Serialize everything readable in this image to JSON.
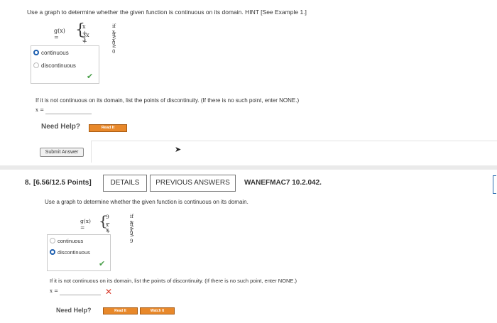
{
  "q7": {
    "prompt": "Use a graph to determine whether the given function is continuous on its domain. HINT [See Example 1.]",
    "func_name": "g(x) =",
    "pieces": [
      {
        "expr": "x + 3",
        "cond": "if x < 0"
      },
      {
        "expr": "3x + 3",
        "cond": "if x ≥ 0"
      }
    ],
    "options": [
      "continuous",
      "discontinuous"
    ],
    "selected": "continuous",
    "discontinuity_prompt": "If it is not continuous on its domain, list the points of discontinuity. (If there is no such point, enter NONE.)",
    "x_label": "x =",
    "x_value": "",
    "need_help": "Need Help?",
    "read_it": "Read It",
    "submit": "Submit Answer"
  },
  "q8": {
    "number": "8.",
    "points": "[6.56/12.5 Points]",
    "details": "DETAILS",
    "previous_answers": "PREVIOUS ANSWERS",
    "source": "WANEFMAC7 10.2.042.",
    "prompt": "Use a graph to determine whether the given function is continuous on its domain.",
    "func_name": "g(x) =",
    "pieces": [
      {
        "expr": "9 − x",
        "cond": "if x ≤ 9"
      },
      {
        "expr": "x + 9",
        "cond": "if x > 9"
      }
    ],
    "options": [
      "continuous",
      "discontinuous"
    ],
    "selected": "discontinuous",
    "discontinuity_prompt": "If it is not continuous on its domain, list the points of discontinuity. (If there is no such point, enter NONE.)",
    "x_label": "x =",
    "x_value": "",
    "need_help": "Need Help?",
    "read_it": "Read It",
    "watch_it": "Watch It"
  },
  "colors": {
    "accent": "#1d5fb0",
    "correct": "#4aa04a",
    "incorrect": "#d83a2b",
    "help_button": "#e8882a"
  }
}
